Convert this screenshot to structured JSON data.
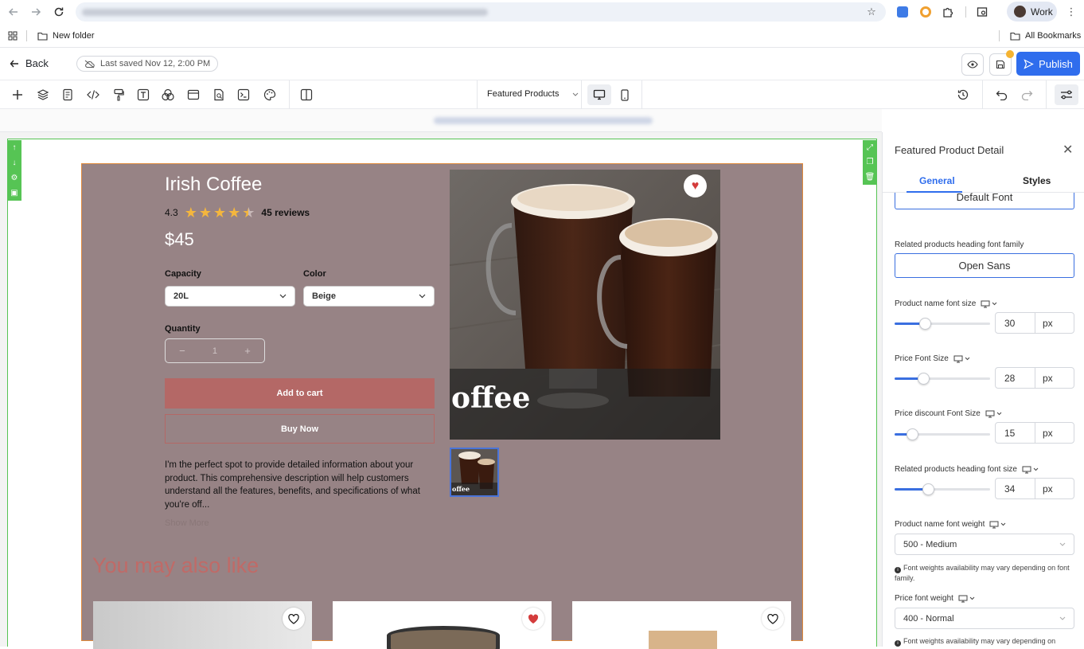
{
  "browser": {
    "profile_label": "Work",
    "bookmarks": {
      "folder": "New folder",
      "all": "All Bookmarks"
    }
  },
  "header": {
    "back_label": "Back",
    "saved_status": "Last saved Nov 12, 2:00 PM",
    "publish_label": "Publish"
  },
  "toolbar": {
    "page_selector": "Featured Products"
  },
  "product": {
    "name": "Irish Coffee",
    "rating": "4.3",
    "reviews": "45 reviews",
    "stars_filled": 4.3,
    "price": "$45",
    "capacity_label": "Capacity",
    "capacity_value": "20L",
    "color_label": "Color",
    "color_value": "Beige",
    "quantity_label": "Quantity",
    "quantity_value": "1",
    "quantity_minus": "−",
    "quantity_plus": "+",
    "add_to_cart": "Add to cart",
    "buy_now": "Buy Now",
    "description": "I'm the perfect spot to provide detailed information about your product. This comprehensive description will help customers understand all the features, benefits, and specifications of what you're off...",
    "more_link": "Show More",
    "image_caption": "offee",
    "thumb_caption": "offee",
    "also_like_heading": "You may also like"
  },
  "panel": {
    "title": "Featured Product Detail",
    "tabs": {
      "general": "General",
      "styles": "Styles"
    },
    "default_font": "Default Font",
    "related_font_family_label": "Related products heading font family",
    "related_font_family_value": "Open Sans",
    "product_name_size_label": "Product name font size",
    "product_name_size": "30",
    "price_size_label": "Price Font Size",
    "price_size": "28",
    "price_discount_size_label": "Price discount Font Size",
    "price_discount_size": "15",
    "related_heading_size_label": "Related products heading font size",
    "related_heading_size": "34",
    "unit": "px",
    "product_name_weight_label": "Product name font weight",
    "product_name_weight": "500 - Medium",
    "weight_note": "Font weights availability may vary depending on font family.",
    "price_weight_label": "Price font weight",
    "price_weight": "400 - Normal",
    "weight_note_2": "Font weights availability may vary depending on"
  },
  "colors": {
    "accent": "#2f6ded",
    "selection_green": "#56c454",
    "product_bg": "#978385",
    "cart_button": "#b46866"
  }
}
